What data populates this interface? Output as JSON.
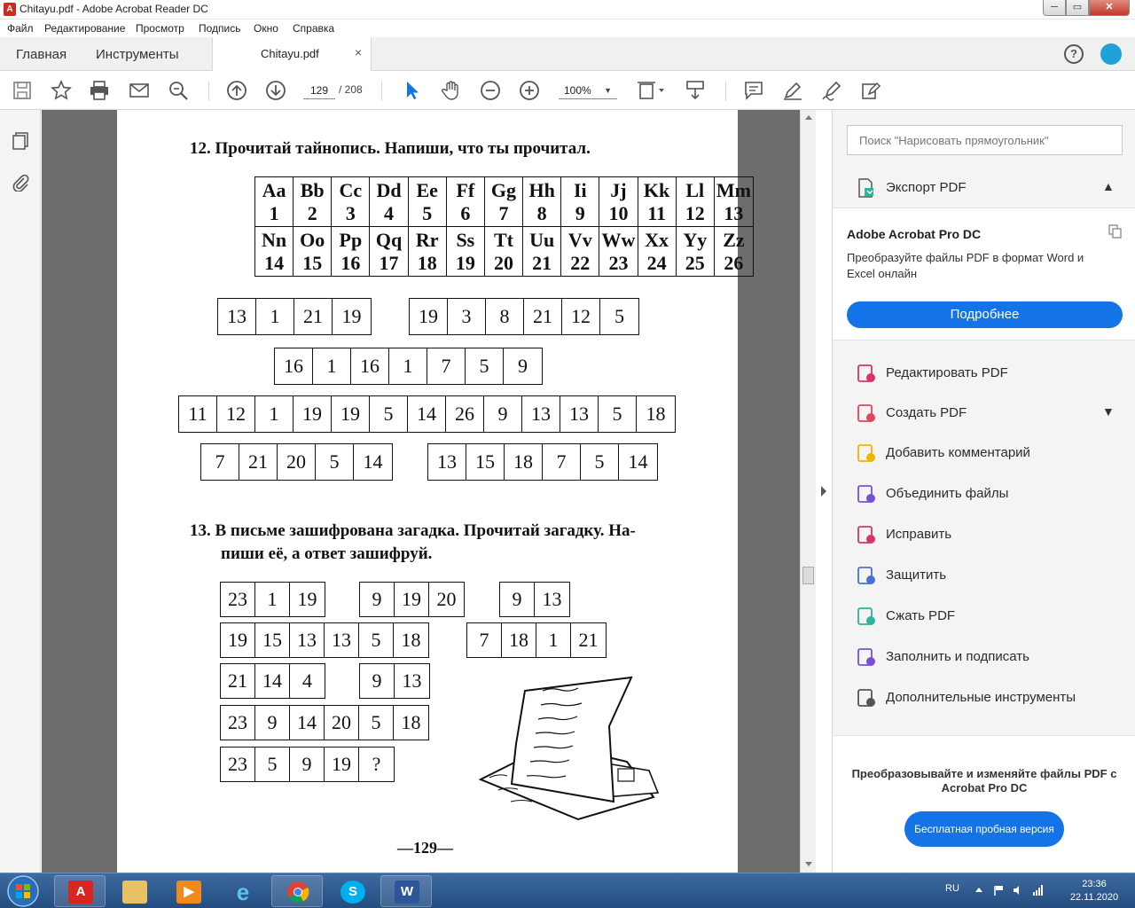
{
  "window": {
    "title": "Chitayu.pdf - Adobe Acrobat Reader DC",
    "app_icon": "acrobat-icon",
    "min_label": "─",
    "max_label": "▭",
    "close_label": "✕"
  },
  "menu": [
    "Файл",
    "Редактирование",
    "Просмотр",
    "Подпись",
    "Окно",
    "Справка"
  ],
  "tabs": {
    "home": "Главная",
    "tools": "Инструменты",
    "document": "Chitayu.pdf",
    "close_glyph": "×"
  },
  "toolbar": {
    "page_current": "129",
    "page_total": "/ 208",
    "zoom": "100%",
    "icons": [
      "save-icon",
      "star-icon",
      "print-icon",
      "mail-icon",
      "search-icon",
      "page-up-icon",
      "page-down-icon",
      "select-arrow-icon",
      "hand-icon",
      "zoom-out-icon",
      "zoom-in-icon",
      "page-fit-icon",
      "scroll-mode-icon",
      "comment-icon",
      "highlight-pen-icon",
      "sign-icon",
      "fill-sign-icon"
    ]
  },
  "doc": {
    "ex12_title": "12.  Прочитай тайнопись. Напиши, что ты прочитал.",
    "alphabet": [
      {
        "l": "Aa",
        "n": "1"
      },
      {
        "l": "Bb",
        "n": "2"
      },
      {
        "l": "Cc",
        "n": "3"
      },
      {
        "l": "Dd",
        "n": "4"
      },
      {
        "l": "Ee",
        "n": "5"
      },
      {
        "l": "Ff",
        "n": "6"
      },
      {
        "l": "Gg",
        "n": "7"
      },
      {
        "l": "Hh",
        "n": "8"
      },
      {
        "l": "Ii",
        "n": "9"
      },
      {
        "l": "Jj",
        "n": "10"
      },
      {
        "l": "Kk",
        "n": "11"
      },
      {
        "l": "Ll",
        "n": "12"
      },
      {
        "l": "Mm",
        "n": "13"
      },
      {
        "l": "Nn",
        "n": "14"
      },
      {
        "l": "Oo",
        "n": "15"
      },
      {
        "l": "Pp",
        "n": "16"
      },
      {
        "l": "Qq",
        "n": "17"
      },
      {
        "l": "Rr",
        "n": "18"
      },
      {
        "l": "Ss",
        "n": "19"
      },
      {
        "l": "Tt",
        "n": "20"
      },
      {
        "l": "Uu",
        "n": "21"
      },
      {
        "l": "Vv",
        "n": "22"
      },
      {
        "l": "Ww",
        "n": "23"
      },
      {
        "l": "Xx",
        "n": "24"
      },
      {
        "l": "Yy",
        "n": "25"
      },
      {
        "l": "Zz",
        "n": "26"
      }
    ],
    "ex12_codes": [
      [
        "13",
        "1",
        "21",
        "19"
      ],
      [
        "19",
        "3",
        "8",
        "21",
        "12",
        "5"
      ],
      [
        "16",
        "1",
        "16",
        "1",
        "7",
        "5",
        "9"
      ],
      [
        "11",
        "12",
        "1",
        "19",
        "19",
        "5",
        "14",
        "26",
        "9",
        "13",
        "13",
        "5",
        "18"
      ],
      [
        "7",
        "21",
        "20",
        "5",
        "14"
      ],
      [
        "13",
        "15",
        "18",
        "7",
        "5",
        "14"
      ]
    ],
    "ex13_title_line1": "13.  В письме зашифрована загадка. Прочитай загадку. На-",
    "ex13_title_line2": "пиши её, а ответ зашифруй.",
    "ex13_codes": [
      [
        "23",
        "1",
        "19"
      ],
      [
        "9",
        "19",
        "20"
      ],
      [
        "9",
        "13"
      ],
      [
        "19",
        "15",
        "13",
        "13",
        "5",
        "18"
      ],
      [
        "7",
        "18",
        "1",
        "21"
      ],
      [
        "21",
        "14",
        "4"
      ],
      [
        "9",
        "13"
      ],
      [
        "23",
        "9",
        "14",
        "20",
        "5",
        "18"
      ],
      [
        "23",
        "5",
        "9",
        "19",
        "?"
      ]
    ],
    "page_number": "—129—"
  },
  "right_panel": {
    "search_placeholder": "Поиск \"Нарисовать прямоугольник\"",
    "export_pdf": "Экспорт PDF",
    "promo_title": "Adobe Acrobat Pro DC",
    "promo_desc": "Преобразуйте файлы PDF в формат Word и Excel онлайн",
    "promo_button": "Подробнее",
    "tools": [
      {
        "label": "Редактировать PDF",
        "icon": "edit-pdf-icon"
      },
      {
        "label": "Создать PDF",
        "icon": "create-pdf-icon"
      },
      {
        "label": "Добавить комментарий",
        "icon": "comment-icon"
      },
      {
        "label": "Объединить файлы",
        "icon": "combine-files-icon"
      },
      {
        "label": "Исправить",
        "icon": "redact-icon"
      },
      {
        "label": "Защитить",
        "icon": "protect-icon"
      },
      {
        "label": "Сжать PDF",
        "icon": "compress-pdf-icon"
      },
      {
        "label": "Заполнить и подписать",
        "icon": "fill-sign-icon"
      },
      {
        "label": "Дополнительные инструменты",
        "icon": "more-tools-icon"
      }
    ],
    "footer_text": "Преобразовывайте и изменяйте файлы PDF с Acrobat Pro DC",
    "footer_button": "Бесплатная пробная версия",
    "colors": {
      "accent": "#1473e6"
    }
  },
  "taskbar": {
    "apps": [
      "acrobat-icon",
      "file-explorer-icon",
      "media-player-icon",
      "internet-explorer-icon",
      "chrome-icon",
      "skype-icon",
      "word-icon"
    ],
    "lang": "RU",
    "time": "23:36",
    "date": "22.11.2020"
  }
}
